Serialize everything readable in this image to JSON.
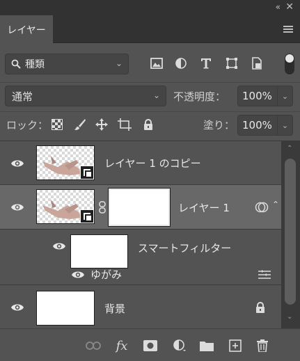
{
  "window": {
    "collapse_glyph": "«",
    "close_glyph": "✕"
  },
  "tab": {
    "label": "レイヤー"
  },
  "filter": {
    "kind_label": "種類"
  },
  "blend": {
    "mode": "通常",
    "opacity_label": "不透明度：",
    "opacity_value": "100%",
    "lock_label": "ロック：",
    "fill_label": "塗り：",
    "fill_value": "100%"
  },
  "layers": [
    {
      "name": "レイヤー 1 のコピー",
      "type": "smart-object",
      "visible": true,
      "selected": false
    },
    {
      "name": "レイヤー 1",
      "type": "smart-object-masked",
      "visible": true,
      "selected": true
    },
    {
      "name": "スマートフィルター",
      "type": "smart-filter",
      "visible": true
    },
    {
      "name": "ゆがみ",
      "type": "filter-effect",
      "visible": true
    },
    {
      "name": "背景",
      "type": "background",
      "visible": true,
      "locked": true
    }
  ],
  "icons": {
    "filter_bar": [
      "search-icon",
      "image-filter-icon",
      "adjustment-filter-icon",
      "type-filter-icon",
      "shape-filter-icon",
      "smart-object-filter-icon"
    ],
    "lock_bar": [
      "lock-transparent-icon",
      "lock-image-icon",
      "lock-position-icon",
      "lock-artboard-icon",
      "lock-all-icon"
    ],
    "bottom_bar": [
      "link-layers-icon",
      "fx-icon",
      "add-mask-icon",
      "new-adjustment-icon",
      "new-group-icon",
      "new-layer-icon",
      "delete-icon"
    ]
  },
  "colors": {
    "panel": "#535353",
    "selected_row": "#686868",
    "chrome": "#323232"
  }
}
